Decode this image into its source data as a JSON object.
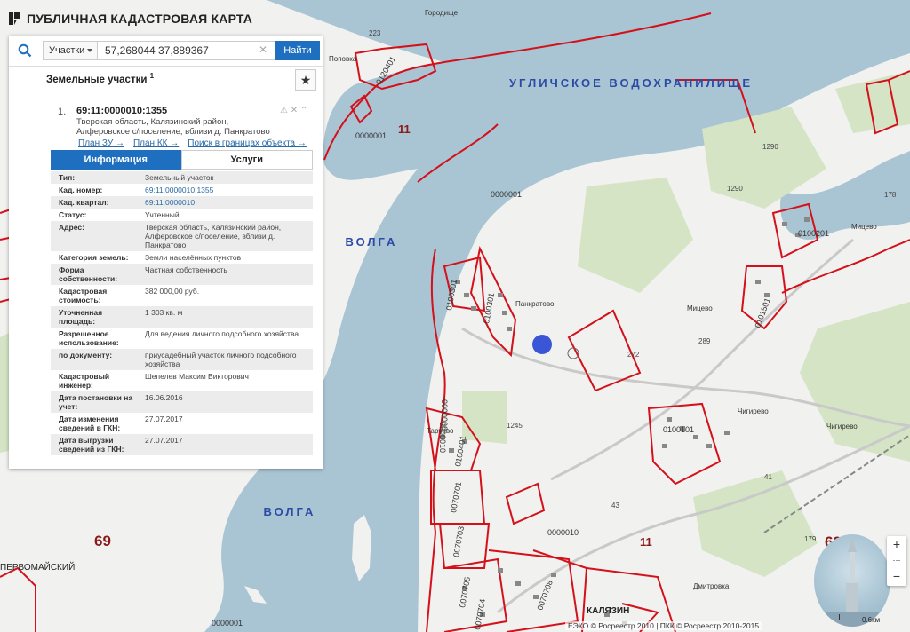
{
  "header": {
    "app_title": "ПУБЛИЧНАЯ КАДАСТРОВАЯ КАРТА"
  },
  "search": {
    "type_label": "Участки",
    "value": "57,268044 37,889367",
    "find_label": "Найти"
  },
  "section": {
    "title": "Земельные участки",
    "count": "1"
  },
  "result": {
    "number": "1.",
    "cad_id": "69:11:0000010:1355",
    "address_lines": [
      "Тверская область, Калязинский район,",
      "Алферовское с/поселение, вблизи д. Панкратово"
    ],
    "links": [
      "План ЗУ →",
      "План КК →",
      "Поиск в границах объекта →"
    ]
  },
  "tabs": [
    "Информация",
    "Услуги"
  ],
  "attributes": [
    {
      "k": "Тип:",
      "v": "Земельный участок"
    },
    {
      "k": "Кад. номер:",
      "v": "69:11:0000010:1355",
      "link": true
    },
    {
      "k": "Кад. квартал:",
      "v": "69:11:0000010",
      "link": true
    },
    {
      "k": "Статус:",
      "v": "Учтенный"
    },
    {
      "k": "Адрес:",
      "v": "Тверская область, Калязинский район, Алферовское с/поселение, вблизи д. Панкратово"
    },
    {
      "k": "Категория земель:",
      "v": "Земли населённых пунктов"
    },
    {
      "k": "Форма собственности:",
      "v": "Частная собственность"
    },
    {
      "k": "Кадастровая стоимость:",
      "v": "382 000,00 руб."
    },
    {
      "k": "Уточненная площадь:",
      "v": "1 303 кв. м"
    },
    {
      "k": "Разрешенное использование:",
      "v": "Для ведения личного подсобного хозяйства"
    },
    {
      "k": "по документу:",
      "v": "приусадебный участок личного подсобного хозяйства"
    },
    {
      "k": "Кадастровый инженер:",
      "v": "Шепелев Максим Викторович"
    },
    {
      "k": "Дата постановки на учет:",
      "v": "16.06.2016"
    },
    {
      "k": "Дата изменения сведений в ГКН:",
      "v": "27.07.2017"
    },
    {
      "k": "Дата выгрузки сведений из ГКН:",
      "v": "27.07.2017"
    }
  ],
  "map": {
    "water_labels": [
      "УГЛИЧСКОЕ ВОДОХРАНИЛИЩЕ",
      "ВОЛГА",
      "ВОЛГА"
    ],
    "place_labels": [
      "Городище",
      "Поповка",
      "Панкратово",
      "Мицево",
      "Мицево",
      "Чигирево",
      "Чигирево",
      "Тарчево",
      "Дмитровка",
      "КАЛЯЗИН",
      "ПЕРВОМАЙСКИЙ"
    ],
    "region_numbers": [
      "69",
      "69",
      "11",
      "11"
    ],
    "parcel_codes": [
      "0120401",
      "0000001",
      "0000001",
      "0000001",
      "0100201",
      "0101501",
      "0100301",
      "0100301",
      "0000000",
      "0100101",
      "0100401",
      "0070701",
      "0070703",
      "0070705",
      "0070708",
      "0070704",
      "0000010",
      "0000010"
    ],
    "parcel_numbers": [
      "223",
      "1290",
      "1290",
      "178",
      "272",
      "289",
      "1245",
      "41",
      "43",
      "179"
    ],
    "colors": {
      "water": "#a9c4d3",
      "land": "#f1f1ef",
      "forest": "#d4e4c4",
      "boundary": "#d4101a",
      "marker": "#3a55d6"
    }
  },
  "controls": {
    "zoom_in": "+",
    "zoom_out": "−",
    "scale": "0.6км"
  },
  "copyright": "ЕЭКО © Росреестр 2010 | ПКК © Росреестр 2010-2015"
}
